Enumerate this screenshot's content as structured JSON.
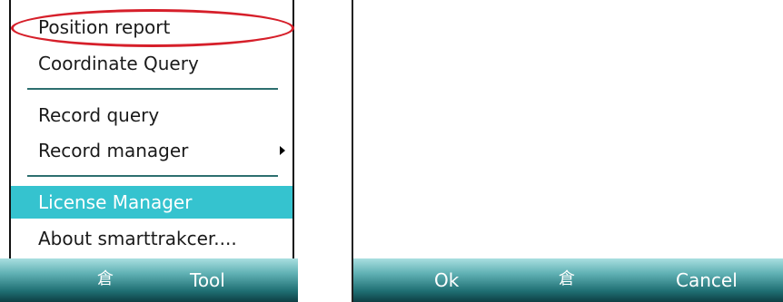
{
  "left": {
    "menu_items": [
      {
        "label": "Position report"
      },
      {
        "label": "Coordinate Query"
      },
      {
        "label": "Record query"
      },
      {
        "label": "Record manager"
      },
      {
        "label": "License Manager"
      },
      {
        "label": "About smarttrakcer...."
      }
    ],
    "softkeys": {
      "center_icon": "keyboard-icon",
      "right_label": "Tool"
    }
  },
  "right": {
    "softkeys": {
      "left_label": "Ok",
      "center_icon": "keyboard-icon",
      "right_label": "Cancel"
    }
  },
  "colors": {
    "selected_item": "#35c3cf",
    "annotation": "#d61f2a",
    "softbar_dark": "#0e3f44"
  }
}
